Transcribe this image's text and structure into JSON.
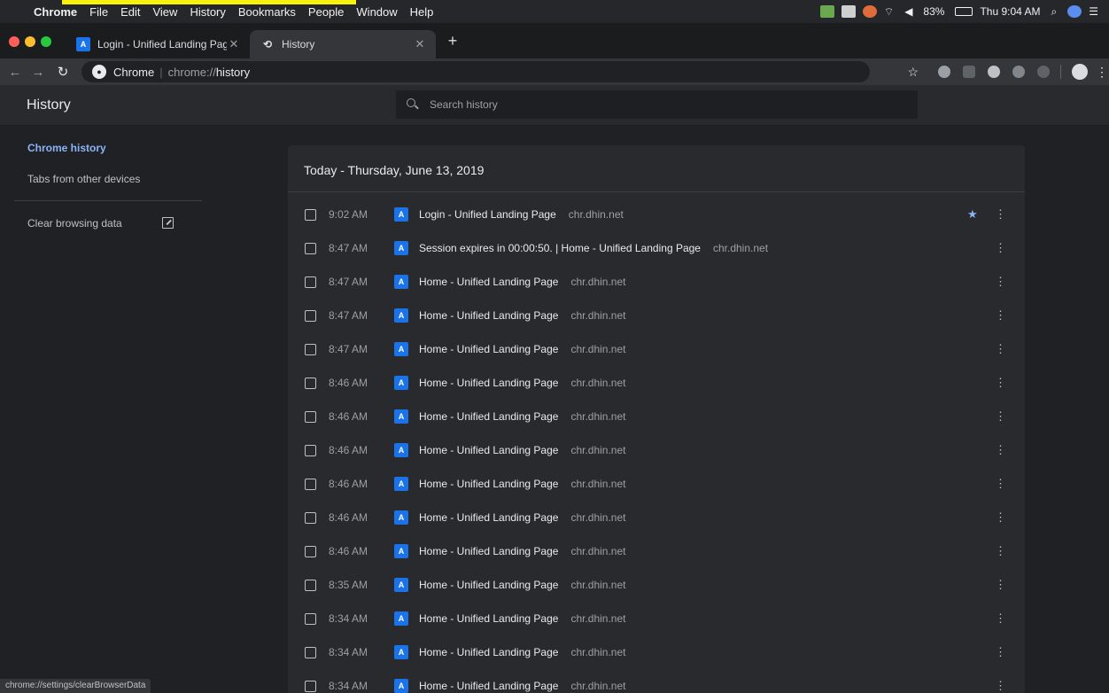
{
  "menubar": {
    "app": "Chrome",
    "items": [
      "File",
      "Edit",
      "View",
      "History",
      "Bookmarks",
      "People",
      "Window",
      "Help"
    ],
    "battery": "83%",
    "clock": "Thu 9:04 AM"
  },
  "tabs": [
    {
      "title": "Login - Unified Landing Page",
      "favicon": "A"
    },
    {
      "title": "History",
      "active": true
    }
  ],
  "toolbar": {
    "site": "Chrome",
    "url_scheme": "chrome://",
    "url_path": "history"
  },
  "header": {
    "title": "History",
    "search_placeholder": "Search history"
  },
  "sidebar": {
    "items": [
      {
        "label": "Chrome history",
        "active": true
      },
      {
        "label": "Tabs from other devices"
      },
      {
        "label": "Clear browsing data"
      }
    ]
  },
  "history": {
    "date_heading": "Today - Thursday, June 13, 2019",
    "favicon": "A",
    "rows": [
      {
        "time": "9:02 AM",
        "title": "Login - Unified Landing Page",
        "domain": "chr.dhin.net",
        "starred": true
      },
      {
        "time": "8:47 AM",
        "title": "Session expires in 00:00:50. | Home - Unified Landing Page",
        "domain": "chr.dhin.net"
      },
      {
        "time": "8:47 AM",
        "title": "Home - Unified Landing Page",
        "domain": "chr.dhin.net"
      },
      {
        "time": "8:47 AM",
        "title": "Home - Unified Landing Page",
        "domain": "chr.dhin.net"
      },
      {
        "time": "8:47 AM",
        "title": "Home - Unified Landing Page",
        "domain": "chr.dhin.net"
      },
      {
        "time": "8:46 AM",
        "title": "Home - Unified Landing Page",
        "domain": "chr.dhin.net"
      },
      {
        "time": "8:46 AM",
        "title": "Home - Unified Landing Page",
        "domain": "chr.dhin.net"
      },
      {
        "time": "8:46 AM",
        "title": "Home - Unified Landing Page",
        "domain": "chr.dhin.net"
      },
      {
        "time": "8:46 AM",
        "title": "Home - Unified Landing Page",
        "domain": "chr.dhin.net"
      },
      {
        "time": "8:46 AM",
        "title": "Home - Unified Landing Page",
        "domain": "chr.dhin.net"
      },
      {
        "time": "8:46 AM",
        "title": "Home - Unified Landing Page",
        "domain": "chr.dhin.net"
      },
      {
        "time": "8:35 AM",
        "title": "Home - Unified Landing Page",
        "domain": "chr.dhin.net"
      },
      {
        "time": "8:34 AM",
        "title": "Home - Unified Landing Page",
        "domain": "chr.dhin.net"
      },
      {
        "time": "8:34 AM",
        "title": "Home - Unified Landing Page",
        "domain": "chr.dhin.net"
      },
      {
        "time": "8:34 AM",
        "title": "Home - Unified Landing Page",
        "domain": "chr.dhin.net"
      }
    ]
  },
  "statusbar": {
    "text": "chrome://settings/clearBrowserData"
  },
  "colors": {
    "accent": "#8ab4f8",
    "background": "#202124",
    "card": "#292a2d",
    "favicon": "#1a73e8",
    "highlight": "#f7f10b"
  }
}
